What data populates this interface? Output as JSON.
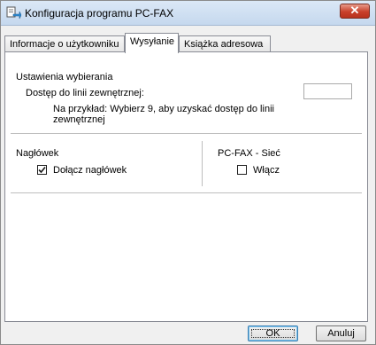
{
  "window": {
    "title": "Konfiguracja programu PC-FAX",
    "close_label": "✕"
  },
  "tabs": [
    {
      "label": "Informacje o użytkowniku",
      "active": false
    },
    {
      "label": "Wysyłanie",
      "active": true
    },
    {
      "label": "Książka adresowa",
      "active": false
    }
  ],
  "dialing": {
    "section_label": "Ustawienia wybierania",
    "outside_line_label": "Dostęp do linii zewnętrznej:",
    "outside_line_value": "",
    "hint": "Na przykład: Wybierz 9, aby uzyskać dostęp do linii zewnętrznej"
  },
  "header": {
    "section_label": "Nagłówek",
    "include_header_label": "Dołącz nagłówek",
    "include_header_checked": true
  },
  "network": {
    "section_label": "PC-FAX - Sieć",
    "enable_label": "Włącz",
    "enable_checked": false
  },
  "buttons": {
    "ok": "OK",
    "cancel": "Anuluj"
  }
}
